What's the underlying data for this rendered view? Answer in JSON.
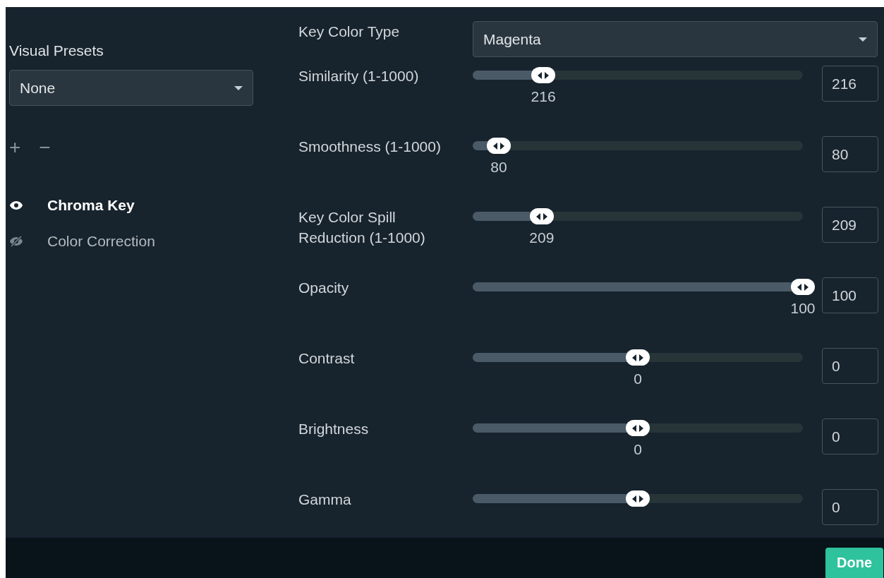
{
  "sidebar": {
    "presets_label": "Visual Presets",
    "presets_value": "None",
    "add": "+",
    "remove": "−",
    "filters": [
      {
        "name": "Chroma Key",
        "visible": true,
        "selected": true
      },
      {
        "name": "Color Correction",
        "visible": false,
        "selected": false
      }
    ]
  },
  "key_color": {
    "label": "Key Color Type",
    "value": "Magenta"
  },
  "sliders": [
    {
      "label": "Similarity (1-1000)",
      "level": 0.214,
      "bubble": "216",
      "value": "216"
    },
    {
      "label": "Smoothness (1-1000)",
      "level": 0.079,
      "bubble": "80",
      "value": "80"
    },
    {
      "label": "Key Color Spill Reduction (1-1000)",
      "level": 0.209,
      "bubble": "209",
      "value": "209"
    },
    {
      "label": "Opacity",
      "level": 1,
      "bubble": "100",
      "value": "100"
    },
    {
      "label": "Contrast",
      "level": 0.5,
      "bubble": "0",
      "value": "0"
    },
    {
      "label": "Brightness",
      "level": 0.5,
      "bubble": "0",
      "value": "0"
    },
    {
      "label": "Gamma",
      "level": 0.5,
      "value": "0"
    }
  ],
  "footer": {
    "done": "Done"
  }
}
